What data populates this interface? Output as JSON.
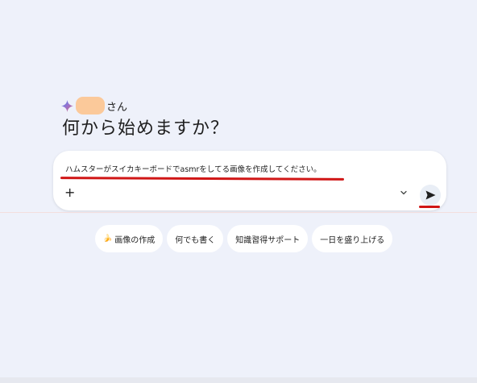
{
  "greeting": {
    "suffix": "さん",
    "headline": "何から始めますか？"
  },
  "prompt": {
    "text": "ハムスターがスイカキーボードでasmrをしてる画像を作成してください。",
    "plus_label": "+"
  },
  "chips": [
    {
      "label": "画像の作成",
      "icon": "banana-icon"
    },
    {
      "label": "何でも書く"
    },
    {
      "label": "知識習得サポート"
    },
    {
      "label": "一日を盛り上げる"
    }
  ],
  "colors": {
    "background": "#eef1fa",
    "annotation_red": "#d01616",
    "redaction": "#fbc99a"
  }
}
